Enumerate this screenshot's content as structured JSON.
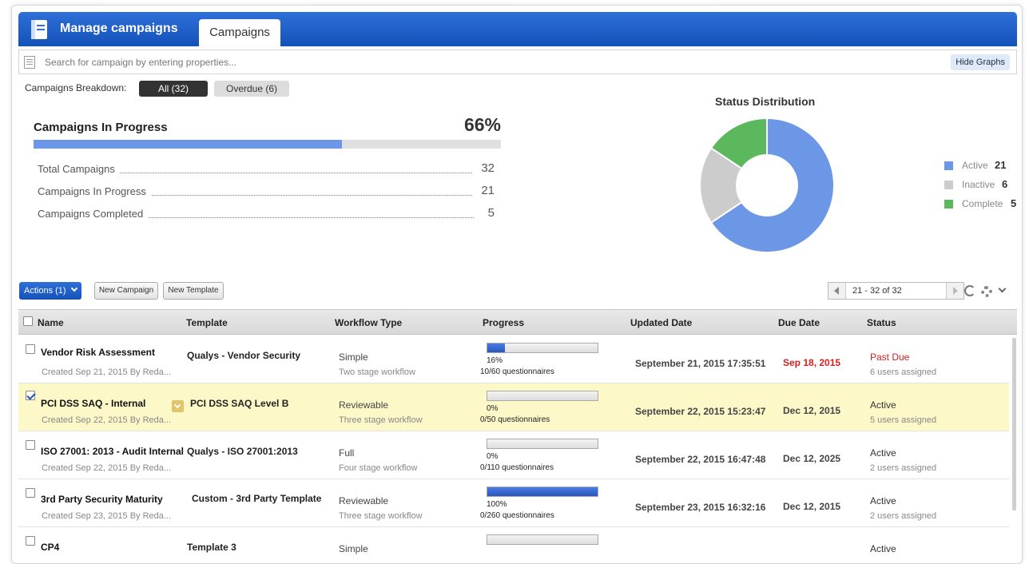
{
  "header": {
    "title": "Manage campaigns",
    "tab": "Campaigns"
  },
  "search": {
    "placeholder": "Search for campaign by entering properties...",
    "hide_graphs": "Hide Graphs"
  },
  "breakdown": {
    "label": "Campaigns Breakdown:",
    "all": "All  (32)",
    "overdue": "Overdue  (6)"
  },
  "progress_card": {
    "title": "Campaigns In Progress",
    "percent": "66%",
    "fill": 0.66,
    "stats": [
      {
        "label": "Total Campaigns",
        "value": "32"
      },
      {
        "label": "Campaigns In Progress",
        "value": "21"
      },
      {
        "label": "Campaigns Completed",
        "value": "5"
      }
    ]
  },
  "chart_data": {
    "type": "pie",
    "title": "Status Distribution",
    "categories": [
      "Active",
      "Inactive",
      "Complete"
    ],
    "values": [
      21,
      6,
      5
    ],
    "colors": [
      "#6b97e6",
      "#cccccc",
      "#5cb85c"
    ],
    "donut": true,
    "legend": "right"
  },
  "toolbar": {
    "actions": "Actions (1)",
    "new_campaign": "New Campaign",
    "new_template": "New Template",
    "pager": "21 - 32 of 32"
  },
  "table": {
    "headers": [
      "Name",
      "Template",
      "Workflow Type",
      "Progress",
      "Updated Date",
      "Due Date",
      "Status"
    ],
    "rows": [
      {
        "name": "Vendor Risk Assessment",
        "created": "Created Sep 21, 2015 By Reda...",
        "template": "Qualys - Vendor Security",
        "workflow": "Simple",
        "workflow_desc": "Two stage workflow",
        "progress": 0.16,
        "percent": "16%",
        "questionnaires": "10/60",
        "q_label": "questionnaires",
        "updated": "September 21, 2015 17:35:51",
        "due": "Sep 18, 2015",
        "status": "Past Due",
        "users": "6 users assigned"
      },
      {
        "name": "PCI DSS SAQ - Internal",
        "created": "Created Sep 22, 2015 By Reda...",
        "template": "PCI DSS SAQ Level B",
        "workflow": "Reviewable",
        "workflow_desc": "Three stage workflow",
        "progress": 0,
        "percent": "0%",
        "questionnaires": "0/50",
        "q_label": "questionnaires",
        "updated": "September 22, 2015 15:23:47",
        "due": "Dec 12, 2015",
        "status": "Active",
        "users": "5 users assigned"
      },
      {
        "name": "ISO 27001: 2013 - Audit Internal",
        "created": "Created Sep 22, 2015 By Reda...",
        "template": "Qualys - ISO 27001:2013",
        "workflow": "Full",
        "workflow_desc": "Four stage workflow",
        "progress": 0,
        "percent": "0%",
        "questionnaires": "0/110",
        "q_label": "questionnaires",
        "updated": "September 22, 2015 16:47:48",
        "due": "Dec 12, 2025",
        "status": "Active",
        "users": "2 users assigned"
      },
      {
        "name": "3rd Party Security Maturity",
        "created": "Created Sep 23, 2015 By Reda...",
        "template": "Custom - 3rd Party Template",
        "workflow": "Reviewable",
        "workflow_desc": "Three stage workflow",
        "progress": 1,
        "percent": "100%",
        "questionnaires": "0/260",
        "q_label": "questionnaires",
        "updated": "September 23, 2015 16:32:16",
        "due": "Dec 12, 2015",
        "status": "Active",
        "users": "2 users assigned"
      },
      {
        "name": "CP4",
        "created": "",
        "template": "Template 3",
        "workflow": "Simple",
        "workflow_desc": "",
        "progress": 0,
        "percent": "",
        "questionnaires": "",
        "q_label": "",
        "updated": "",
        "due": "",
        "status": "Active",
        "users": ""
      }
    ]
  }
}
